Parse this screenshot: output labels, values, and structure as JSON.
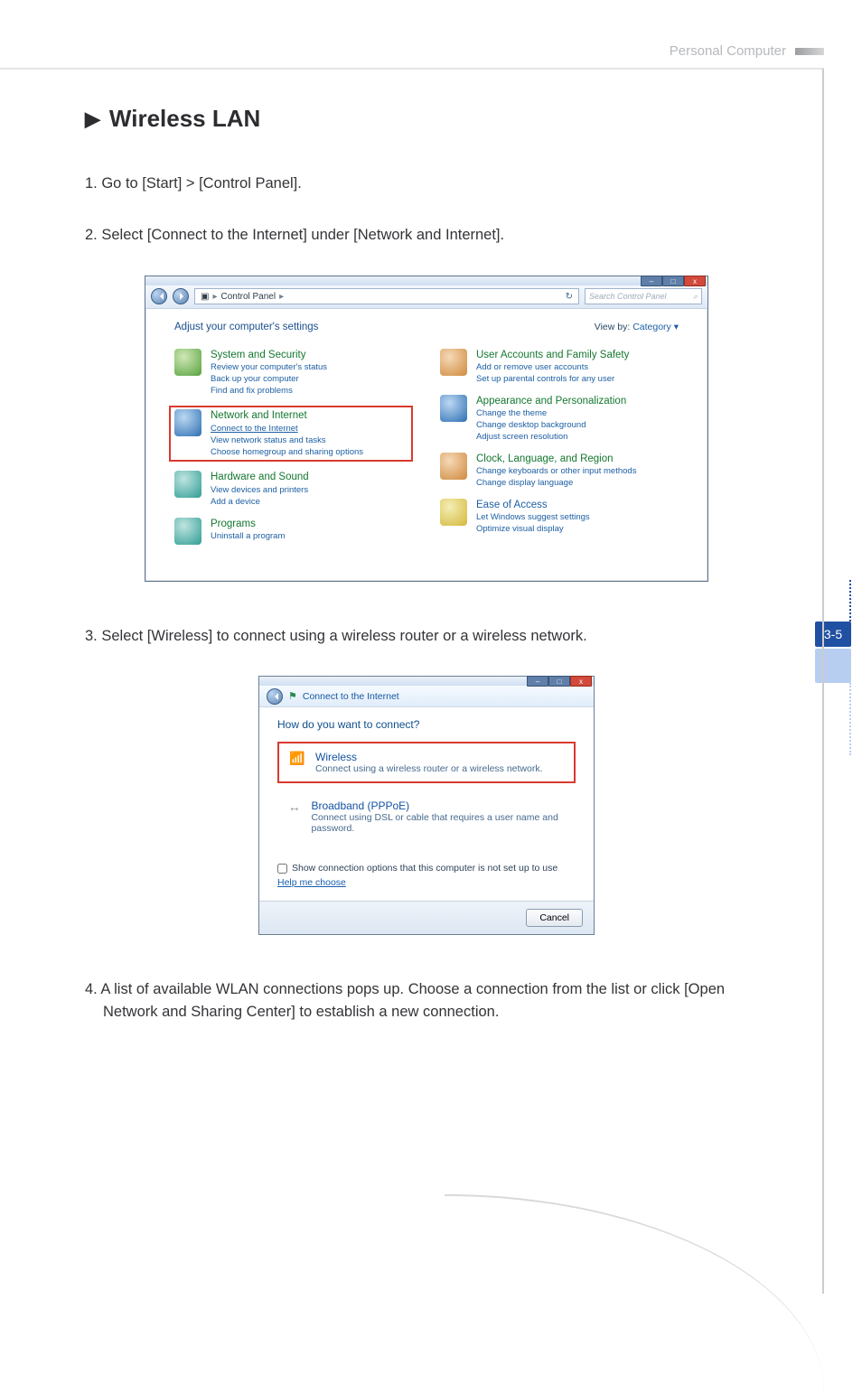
{
  "header": {
    "label": "Personal Computer"
  },
  "sideTab": {
    "page": "3-5"
  },
  "section": {
    "arrow": "▶",
    "title": "Wireless LAN"
  },
  "steps": {
    "s1": "1. Go to [Start] > [Control Panel].",
    "s2": "2. Select [Connect to the Internet] under [Network and Internet].",
    "s3": "3. Select [Wireless] to connect using a wireless router or a wireless network.",
    "s4": "4. A list of available WLAN connections pops up. Choose a connection from the list or click [Open Network and Sharing Center] to establish a new connection."
  },
  "cp": {
    "winControls": {
      "min": "–",
      "max": "□",
      "close": "x"
    },
    "breadcrumb": {
      "icon": "▣",
      "sep1": "▸",
      "label": "Control Panel",
      "sep2": "▸",
      "refresh": "↻"
    },
    "search": {
      "placeholder": "Search Control Panel",
      "icon": "⌕"
    },
    "adjust": "Adjust your computer's settings",
    "viewBy": "View by:",
    "viewVal": "Category ▾",
    "items": {
      "sys": {
        "title": "System and Security",
        "l1": "Review your computer's status",
        "l2": "Back up your computer",
        "l3": "Find and fix problems"
      },
      "net": {
        "title": "Network and Internet",
        "l1": "Connect to the Internet",
        "l2": "View network status and tasks",
        "l3": "Choose homegroup and sharing options"
      },
      "hw": {
        "title": "Hardware and Sound",
        "l1": "View devices and printers",
        "l2": "Add a device"
      },
      "prog": {
        "title": "Programs",
        "l1": "Uninstall a program"
      },
      "user": {
        "title": "User Accounts and Family Safety",
        "l1": "Add or remove user accounts",
        "l2": "Set up parental controls for any user"
      },
      "app": {
        "title": "Appearance and Personalization",
        "l1": "Change the theme",
        "l2": "Change desktop background",
        "l3": "Adjust screen resolution"
      },
      "clk": {
        "title": "Clock, Language, and Region",
        "l1": "Change keyboards or other input methods",
        "l2": "Change display language"
      },
      "ease": {
        "title": "Ease of Access",
        "l1": "Let Windows suggest settings",
        "l2": "Optimize visual display"
      }
    }
  },
  "dlg": {
    "winControls": {
      "min": "–",
      "max": "□",
      "close": "x"
    },
    "strip": {
      "icon": "⚑",
      "label": "Connect to the Internet"
    },
    "question": "How do you want to connect?",
    "wireless": {
      "icon": "📶",
      "title": "Wireless",
      "sub": "Connect using a wireless router or a wireless network."
    },
    "pppoe": {
      "icon": "↔",
      "title": "Broadband (PPPoE)",
      "sub": "Connect using DSL or cable that requires a user name and password."
    },
    "showOpt": "Show connection options that this computer is not set up to use",
    "help": "Help me choose",
    "cancel": "Cancel"
  }
}
